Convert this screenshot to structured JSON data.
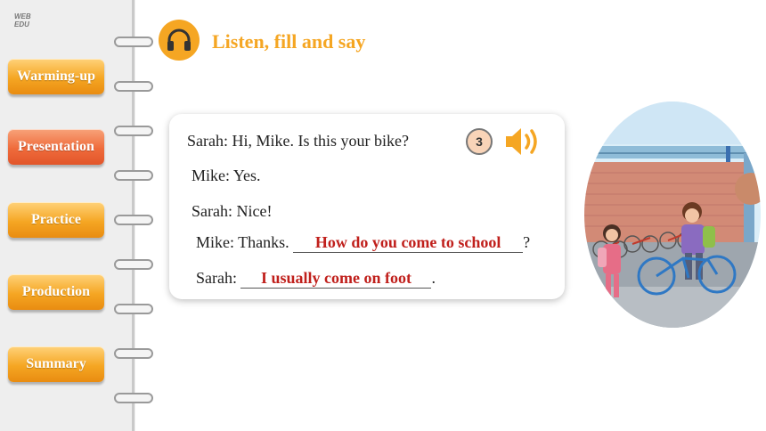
{
  "logo": {
    "line1": "WEB",
    "line2": "EDU"
  },
  "sidebar": {
    "items": [
      {
        "label": "Warming-up"
      },
      {
        "label": "Presentation"
      },
      {
        "label": "Practice"
      },
      {
        "label": "Production"
      },
      {
        "label": "Summary"
      }
    ],
    "active": "Presentation"
  },
  "header": {
    "title": "Listen, fill and say",
    "icon": "headphones-icon"
  },
  "dialog": {
    "number": "3",
    "lines": [
      {
        "text": "Sarah: Hi, Mike. Is this your bike?"
      },
      {
        "text": "Mike: Yes."
      },
      {
        "text": "Sarah: Nice!"
      },
      {
        "prefix": "Mike: Thanks.",
        "answer": "How do you come to school",
        "suffix": "?"
      },
      {
        "prefix": "Sarah:",
        "answer": "I usually come on foot",
        "suffix": "."
      }
    ]
  },
  "colors": {
    "accent": "#f5a623",
    "active": "#e8552a",
    "answer": "#c0201c"
  }
}
